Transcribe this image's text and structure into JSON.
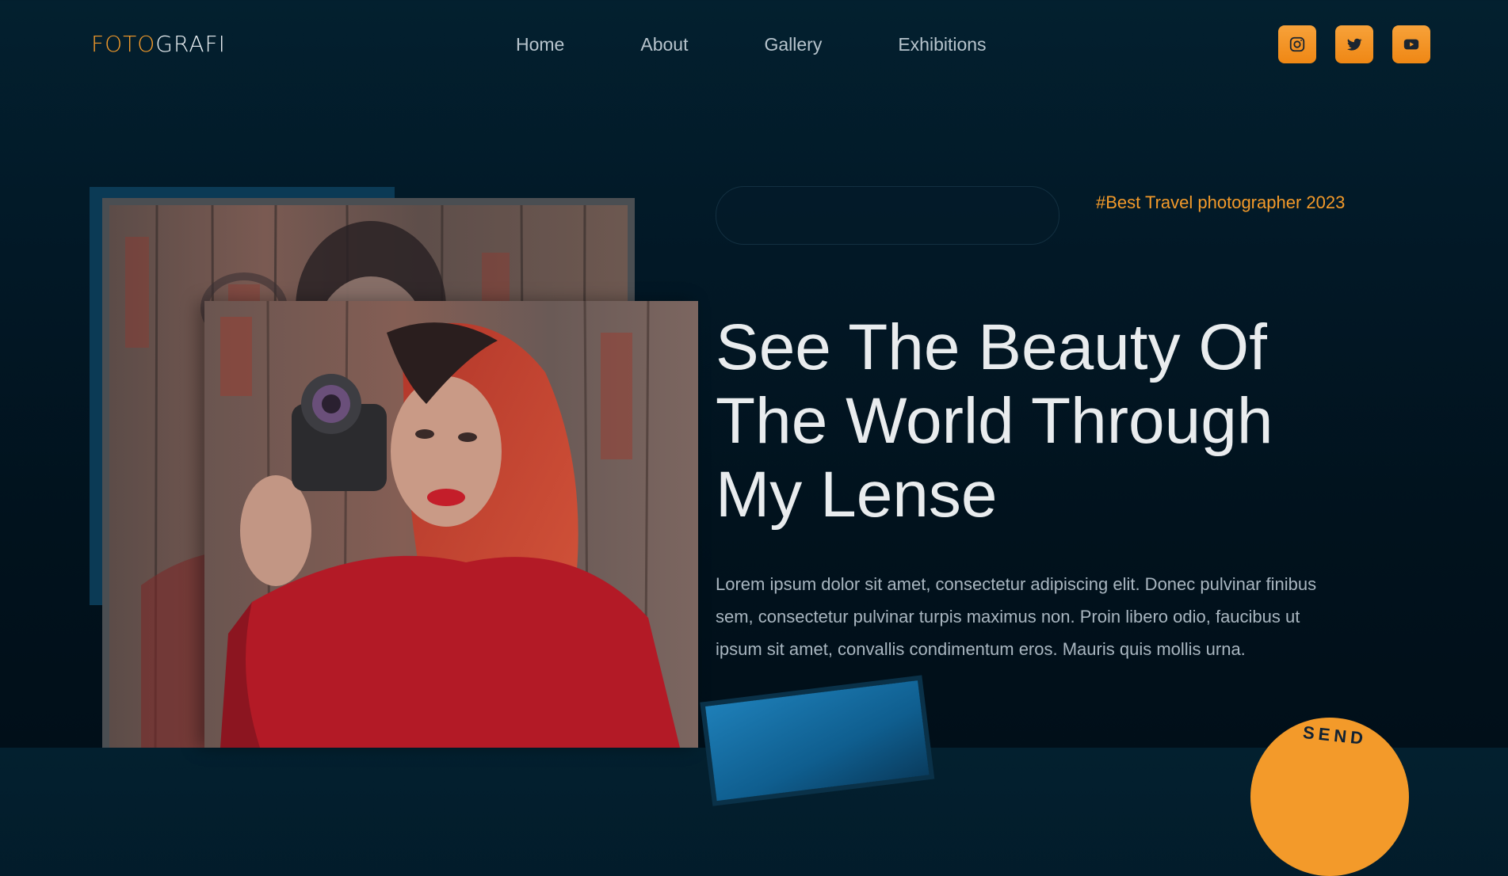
{
  "header": {
    "logo": {
      "part1": "FOTO",
      "part2": "GRAFI"
    },
    "nav": [
      "Home",
      "About",
      "Gallery",
      "Exhibitions"
    ],
    "social": [
      "instagram-icon",
      "twitter-icon",
      "youtube-icon"
    ]
  },
  "hero": {
    "tagline": "#Best Travel photographer 2023",
    "title_lines": [
      "See The Beauty Of",
      "The World Through",
      "My Lense"
    ],
    "description": "Lorem ipsum dolor sit amet, consectetur adipiscing elit. Donec pulvinar finibus sem, consectetur pulvinar turpis maximus non. Proin libero odio, faucibus ut ipsum sit amet, convallis condimentum eros. Mauris quis mollis urna."
  },
  "decor": {
    "send_badge": "SEND"
  },
  "colors": {
    "accent": "#f39a2a",
    "background": "#021826",
    "text": "#e9ecee",
    "muted_text": "#a9b6c0"
  }
}
